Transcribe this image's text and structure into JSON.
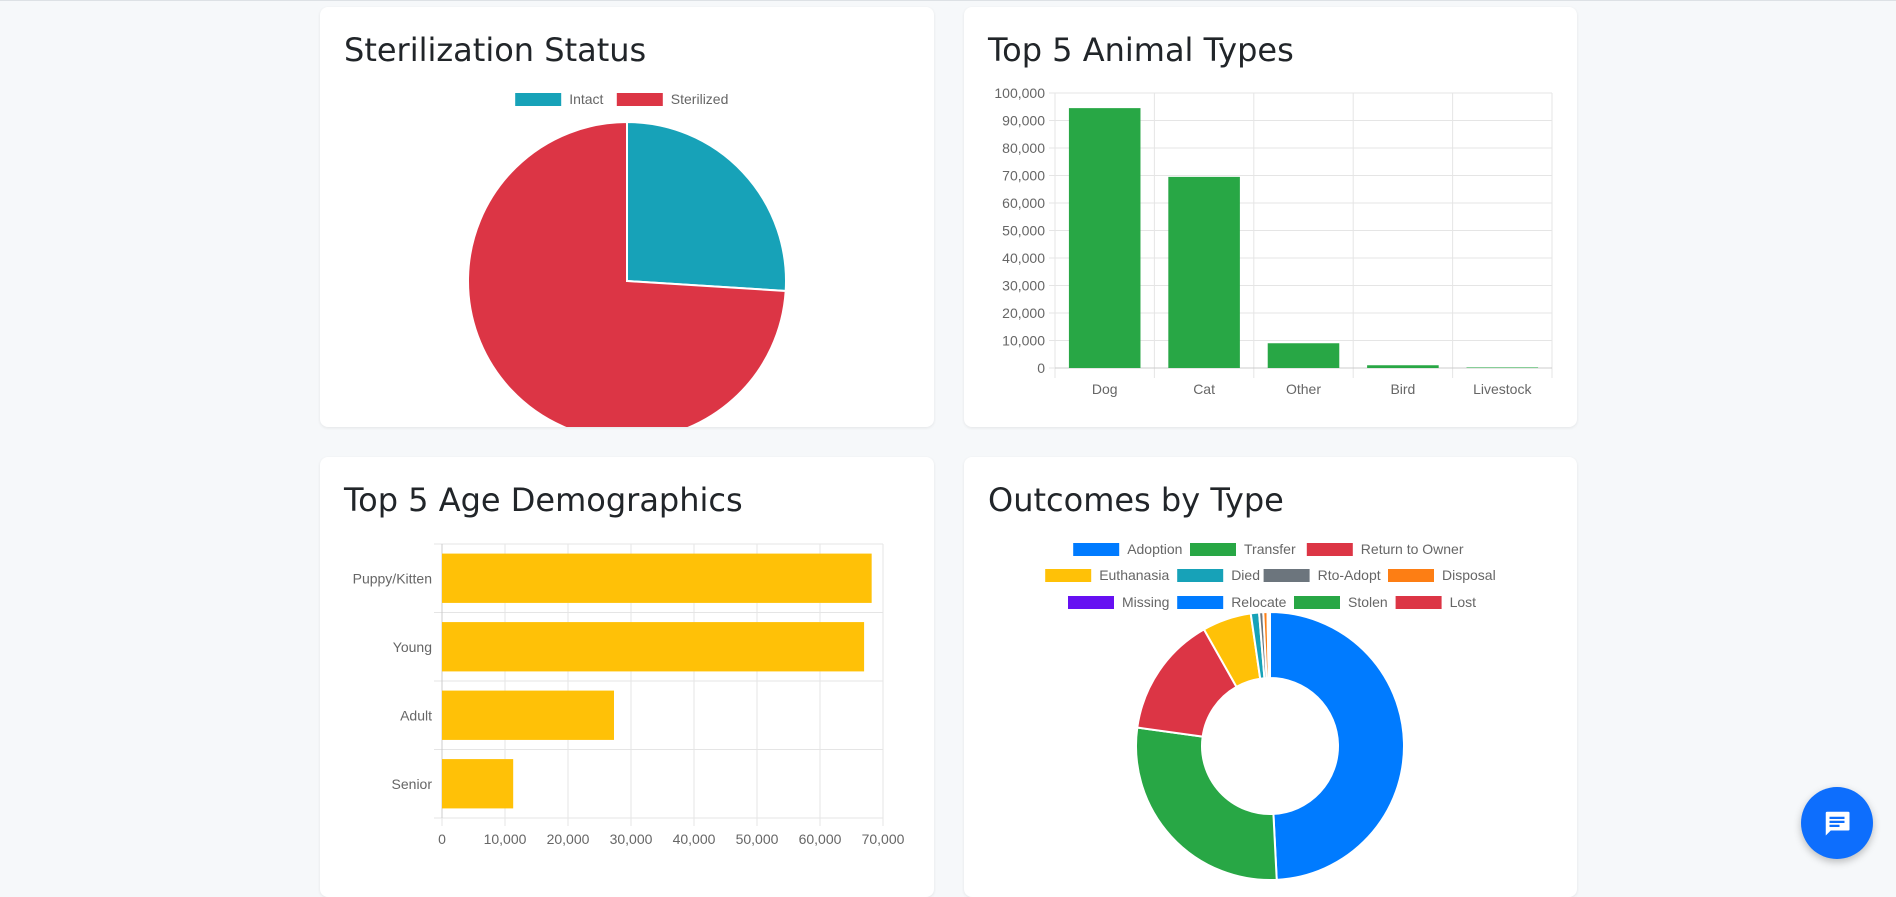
{
  "cards": {
    "sterilization": {
      "title": "Sterilization Status"
    },
    "animal_types": {
      "title": "Top 5 Animal Types"
    },
    "age": {
      "title": "Top 5 Age Demographics"
    },
    "outcomes": {
      "title": "Outcomes by Type"
    }
  },
  "chat_icon": "chat-bubble-icon",
  "chart_data": [
    {
      "id": "sterilization",
      "type": "pie",
      "title": "Sterilization Status",
      "labels": [
        "Intact",
        "Sterilized"
      ],
      "values": [
        26,
        74
      ],
      "colors": [
        "#17a2b8",
        "#dc3545"
      ],
      "legend": "top"
    },
    {
      "id": "animal_types",
      "type": "bar",
      "title": "Top 5 Animal Types",
      "categories": [
        "Dog",
        "Cat",
        "Other",
        "Bird",
        "Livestock"
      ],
      "values": [
        94500,
        69500,
        9000,
        1000,
        200
      ],
      "color": "#28a745",
      "ylim": [
        0,
        100000
      ],
      "yticks": [
        "0",
        "10,000",
        "20,000",
        "30,000",
        "40,000",
        "50,000",
        "60,000",
        "70,000",
        "80,000",
        "90,000",
        "100,000"
      ],
      "grid": true,
      "legend": "none"
    },
    {
      "id": "age",
      "type": "bar",
      "orientation": "horizontal",
      "title": "Top 5 Age Demographics",
      "categories": [
        "Puppy/Kitten",
        "Young",
        "Adult",
        "Senior"
      ],
      "values": [
        68200,
        67000,
        27300,
        11300
      ],
      "color": "#ffc107",
      "xlim": [
        0,
        70000
      ],
      "xticks": [
        "0",
        "10,000",
        "20,000",
        "30,000",
        "40,000",
        "50,000",
        "60,000",
        "70,000"
      ],
      "grid": true,
      "legend": "none"
    },
    {
      "id": "outcomes",
      "type": "pie",
      "subtype": "doughnut",
      "title": "Outcomes by Type",
      "labels": [
        "Adoption",
        "Transfer",
        "Return to Owner",
        "Euthanasia",
        "Died",
        "Rto-Adopt",
        "Disposal",
        "Missing",
        "Relocate",
        "Stolen",
        "Lost"
      ],
      "values": [
        49.2,
        28.0,
        14.6,
        5.9,
        1.0,
        0.5,
        0.5,
        0.1,
        0.1,
        0.05,
        0.05
      ],
      "colors": [
        "#007bff",
        "#28a745",
        "#dc3545",
        "#ffc107",
        "#17a2b8",
        "#6c757d",
        "#fd7e14",
        "#6610f2",
        "#007bff",
        "#28a745",
        "#dc3545"
      ],
      "legend": "top"
    }
  ]
}
